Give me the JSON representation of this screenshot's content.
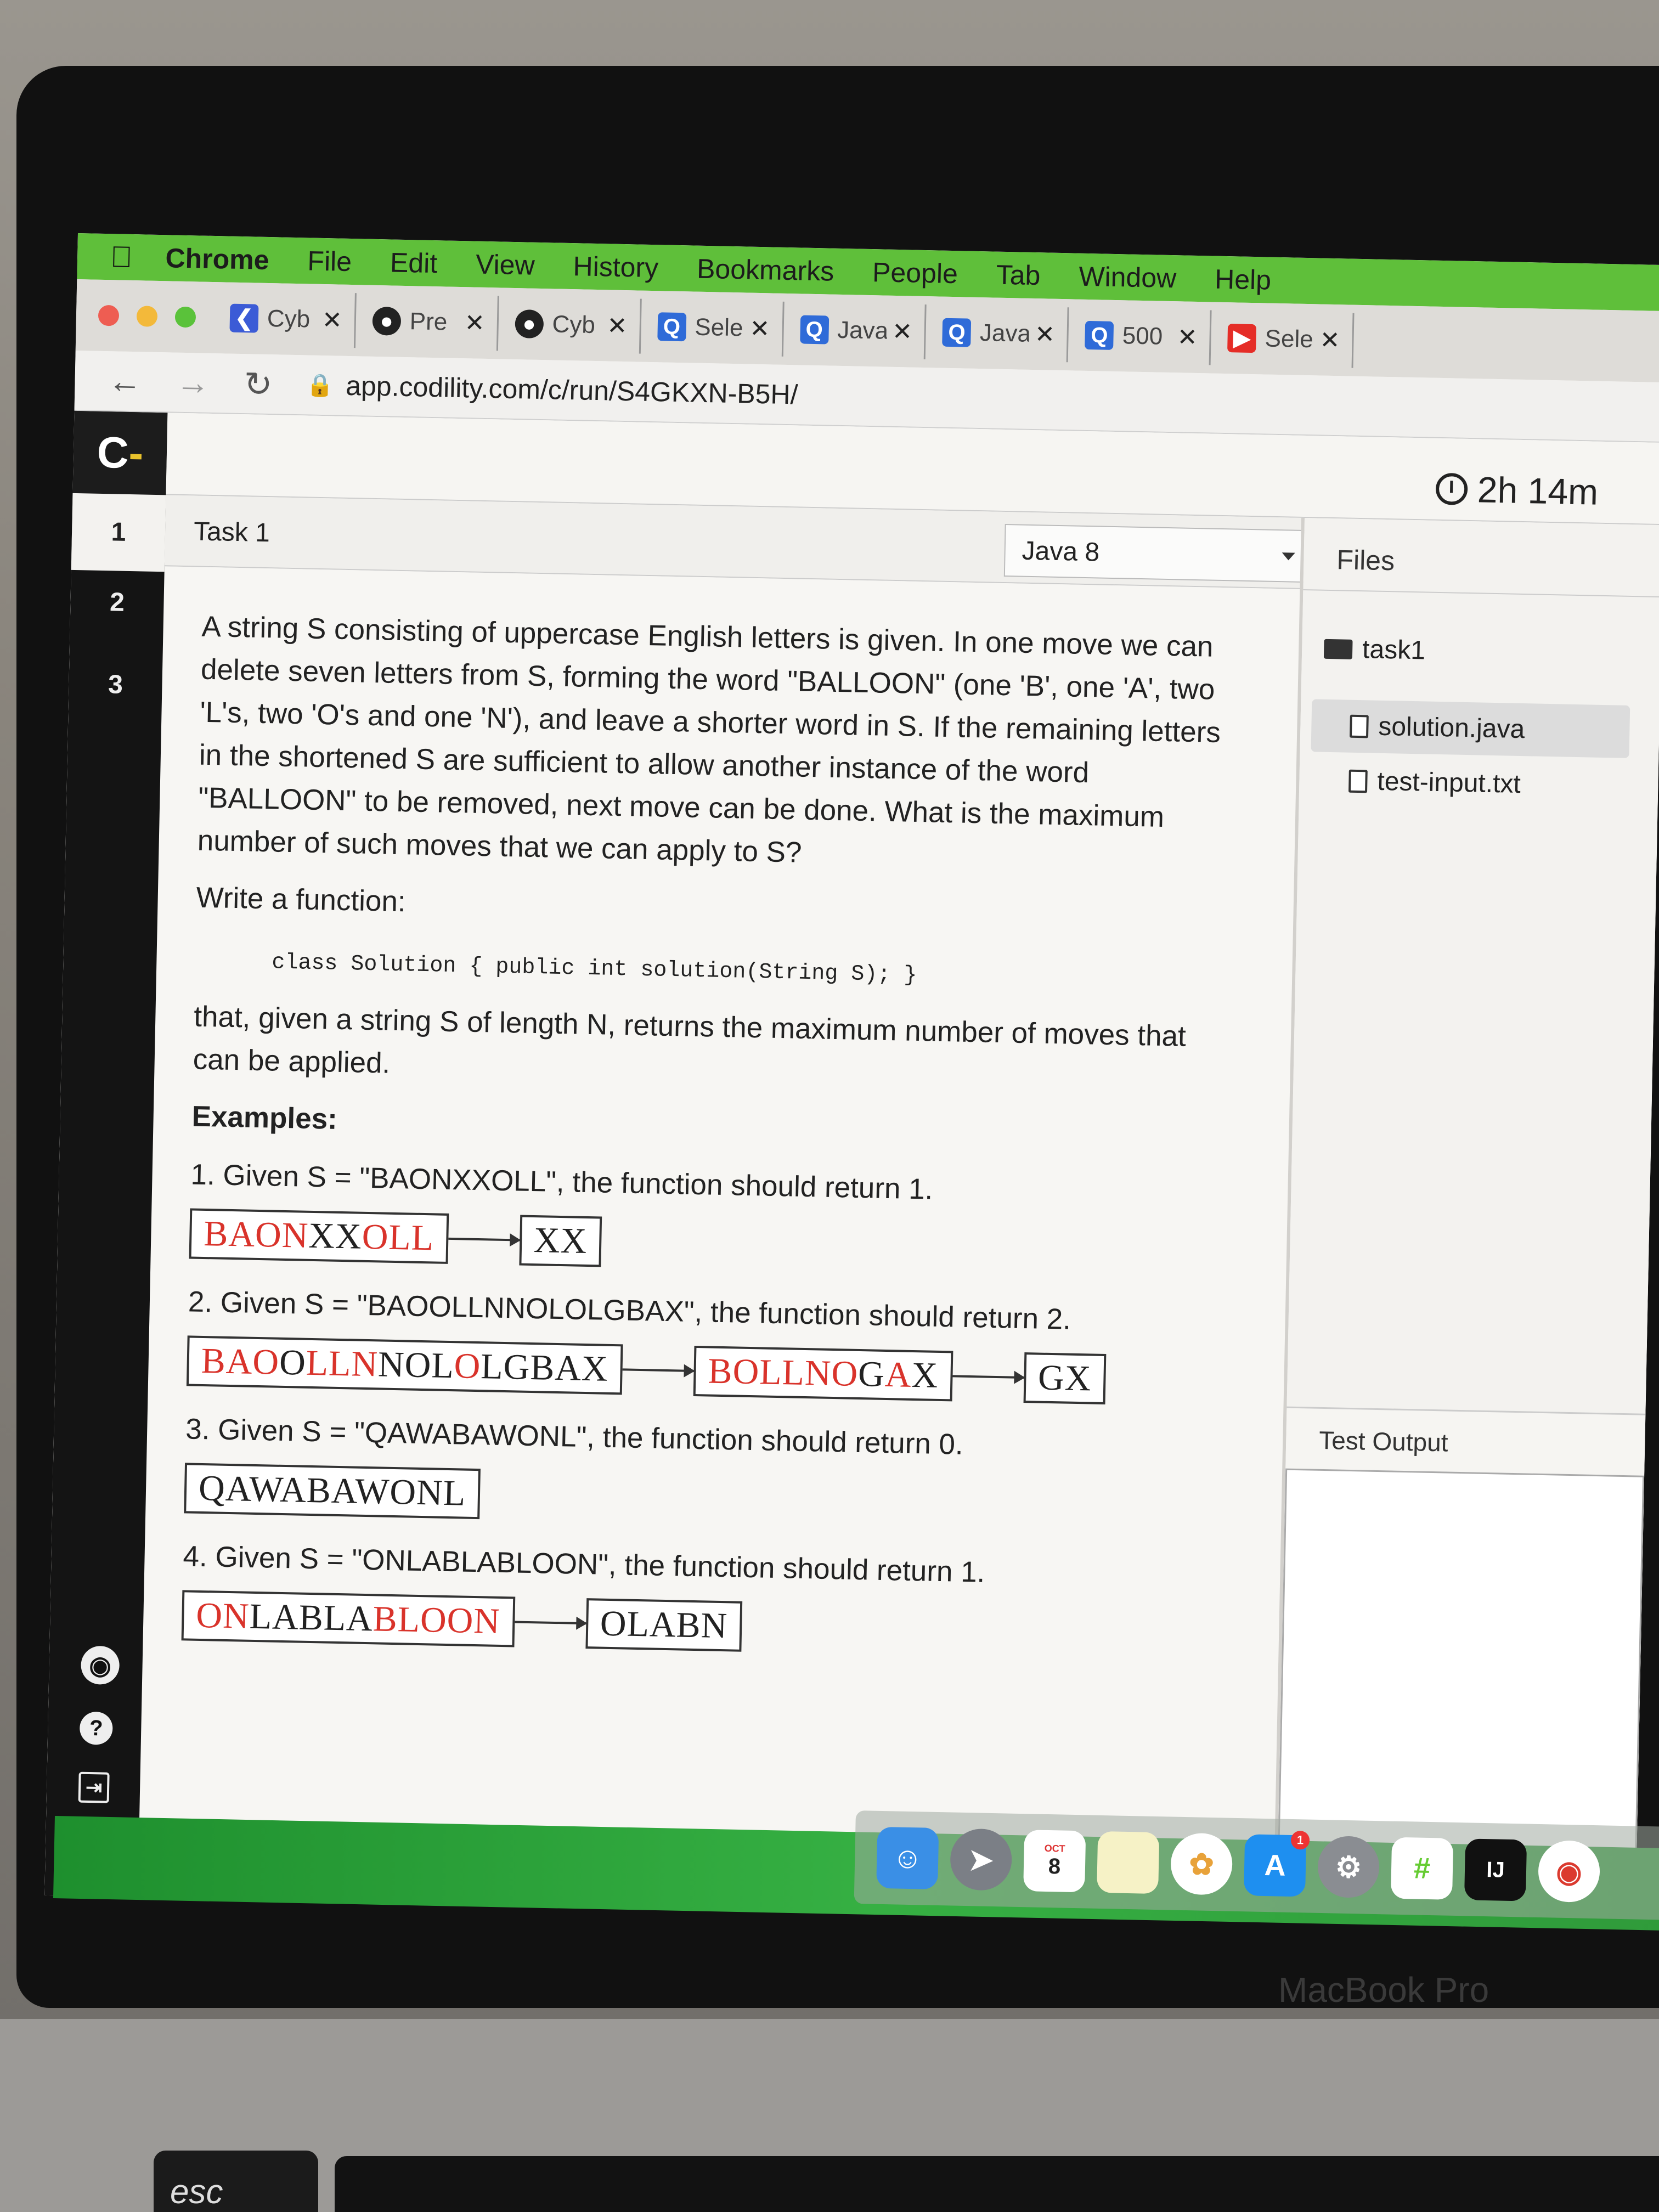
{
  "menubar": {
    "items": [
      "Chrome",
      "File",
      "Edit",
      "View",
      "History",
      "Bookmarks",
      "People",
      "Tab",
      "Window",
      "Help"
    ]
  },
  "tabs": [
    {
      "icon": "codility-icon",
      "title": "Cyb",
      "color": "#3b5bd6"
    },
    {
      "icon": "github-icon",
      "title": "Pre",
      "color": "#222222"
    },
    {
      "icon": "github-icon",
      "title": "Cyb",
      "color": "#222222"
    },
    {
      "icon": "q-icon",
      "title": "Sele",
      "color": "#2f6bd8"
    },
    {
      "icon": "q-icon",
      "title": "Java",
      "color": "#2f6bd8"
    },
    {
      "icon": "q-icon",
      "title": "Java",
      "color": "#2f6bd8"
    },
    {
      "icon": "q-icon",
      "title": "500",
      "color": "#2f6bd8"
    },
    {
      "icon": "youtube-icon",
      "title": "Sele",
      "color": "#e52d27"
    }
  ],
  "address": {
    "url": "app.codility.com/c/run/S4GKXN-B5H/"
  },
  "app": {
    "logo": "C",
    "timer": "2h 14m",
    "task_numbers": [
      "1",
      "2",
      "3"
    ],
    "task_title": "Task 1",
    "language": "Java 8",
    "files_header": "Files",
    "folder": "task1",
    "files": [
      "solution.java",
      "test-input.txt"
    ],
    "output_header": "Test Output"
  },
  "description": {
    "intro": "A string S consisting of uppercase English letters is given. In one move we can delete seven letters from S, forming the word \"BALLOON\" (one 'B', one 'A', two 'L's, two 'O's and one 'N'), and leave a shorter word in S. If the remaining letters in the shortened S are sufficient to allow another instance of the word \"BALLOON\" to be removed, next move can be done. What is the maximum number of such moves that we can apply to S?",
    "write_function": "Write a function:",
    "signature": "class Solution { public int solution(String S); }",
    "after": "that, given a string S of length N, returns the maximum number of moves that can be applied.",
    "examples_heading": "Examples:",
    "examples": [
      {
        "text": "1. Given S = \"BAONXXOLL\", the function should return 1."
      },
      {
        "text": "2. Given S = \"BAOOLLNNOLOLGBAX\", the function should return 2."
      },
      {
        "text": "3. Given S = \"QAWABAWONL\", the function should return 0."
      },
      {
        "text": "4. Given S = \"ONLABLABLOON\", the function should return 1."
      }
    ]
  },
  "dock": {
    "calendar_month": "OCT",
    "calendar_day": "8",
    "appstore_badge": "1",
    "intellij_label": "IJ"
  },
  "hardware": {
    "brand": "MacBook Pro",
    "esc": "esc"
  }
}
